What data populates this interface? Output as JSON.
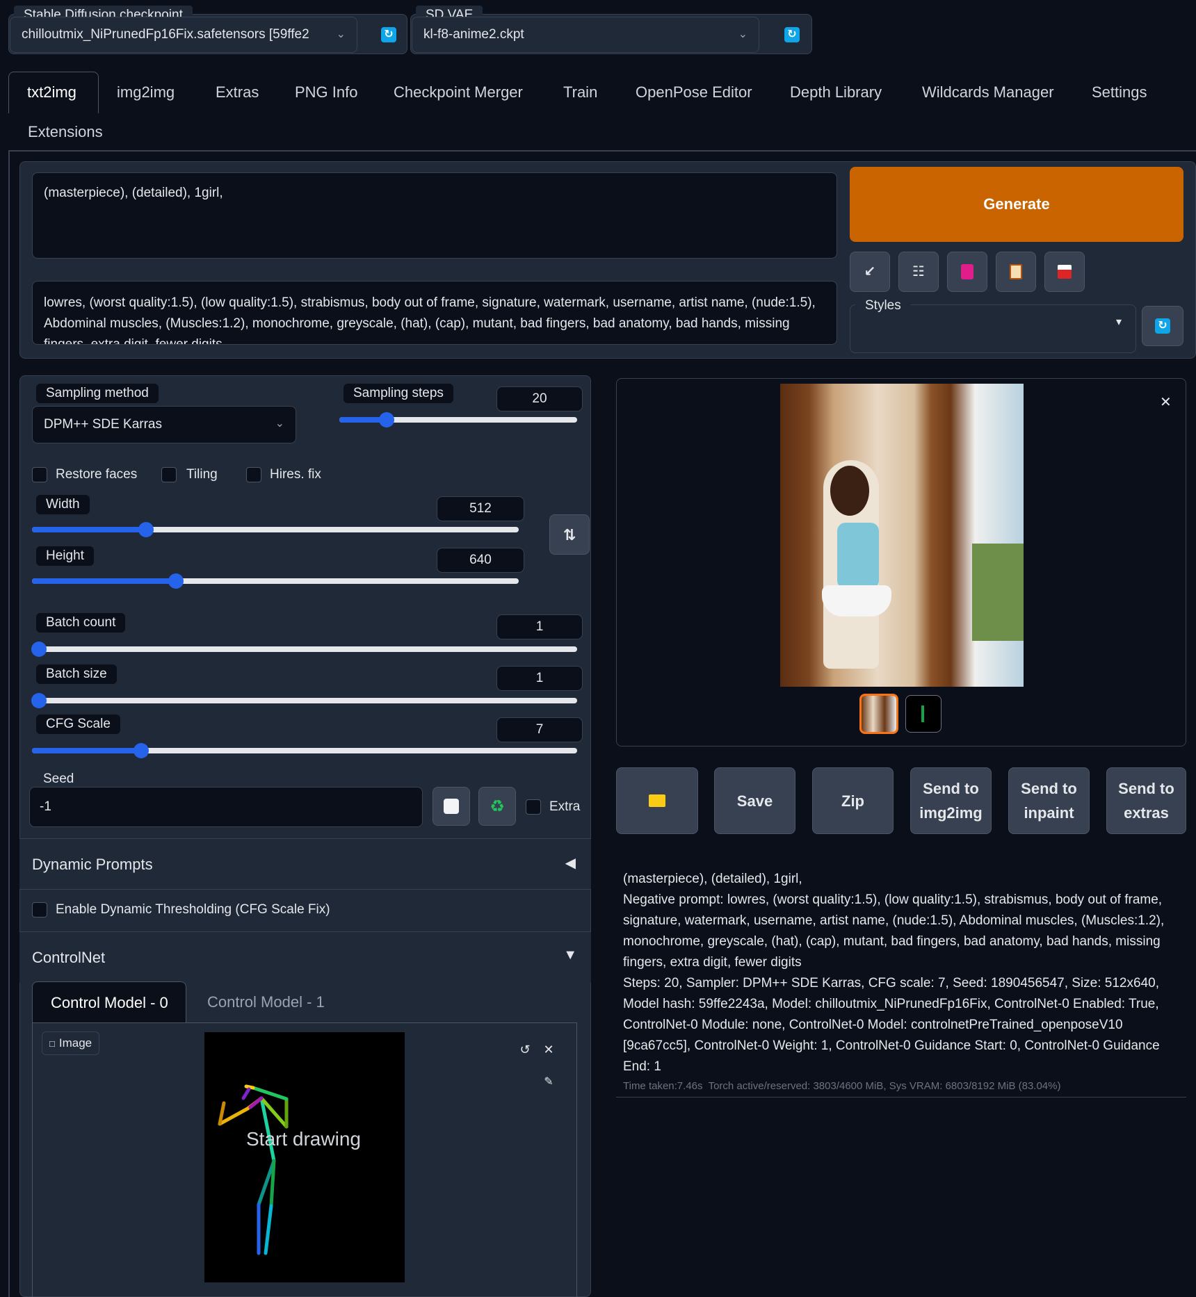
{
  "checkpoint": {
    "label": "Stable Diffusion checkpoint",
    "value": "chilloutmix_NiPrunedFp16Fix.safetensors [59ffe2"
  },
  "vae": {
    "label": "SD VAE",
    "value": "kl-f8-anime2.ckpt"
  },
  "tabs": [
    "txt2img",
    "img2img",
    "Extras",
    "PNG Info",
    "Checkpoint Merger",
    "Train",
    "OpenPose Editor",
    "Depth Library",
    "Wildcards Manager",
    "Settings",
    "Extensions"
  ],
  "prompt": {
    "positive": "(masterpiece), (detailed), 1girl,",
    "negative": "lowres, (worst quality:1.5), (low quality:1.5), strabismus, body out of frame, signature, watermark, username, artist name, (nude:1.5), Abdominal muscles, (Muscles:1.2), monochrome, greyscale, (hat), (cap), mutant, bad fingers, bad anatomy, bad hands, missing fingers, extra digit, fewer digits"
  },
  "generate_label": "Generate",
  "styles_label": "Styles",
  "sampling": {
    "method_label": "Sampling method",
    "method": "DPM++ SDE Karras",
    "steps_label": "Sampling steps",
    "steps": "20",
    "steps_frac": 0.2
  },
  "checks": {
    "restore": "Restore faces",
    "tiling": "Tiling",
    "hires": "Hires. fix"
  },
  "width": {
    "label": "Width",
    "value": "512",
    "frac": 0.234
  },
  "height": {
    "label": "Height",
    "value": "640",
    "frac": 0.296
  },
  "batch_count": {
    "label": "Batch count",
    "value": "1",
    "frac": 0
  },
  "batch_size": {
    "label": "Batch size",
    "value": "1",
    "frac": 0
  },
  "cfg": {
    "label": "CFG Scale",
    "value": "7",
    "frac": 0.2
  },
  "seed": {
    "label": "Seed",
    "value": "-1",
    "extra": "Extra"
  },
  "dynamic_prompts": "Dynamic Prompts",
  "dyn_thresh": "Enable Dynamic Thresholding (CFG Scale Fix)",
  "controlnet": {
    "title": "ControlNet",
    "tab0": "Control Model - 0",
    "tab1": "Control Model - 1",
    "image_label": "Image",
    "start_drawing": "Start drawing"
  },
  "actions": {
    "save": "Save",
    "zip": "Zip",
    "send_img2img": "Send to img2img",
    "send_inpaint": "Send to inpaint",
    "send_extras": "Send to extras"
  },
  "info": {
    "prompt": "(masterpiece), (detailed), 1girl,",
    "negative": "Negative prompt: lowres, (worst quality:1.5), (low quality:1.5), strabismus, body out of frame, signature, watermark, username, artist name, (nude:1.5), Abdominal muscles, (Muscles:1.2), monochrome, greyscale, (hat), (cap), mutant, bad fingers, bad anatomy, bad hands, missing fingers, extra digit, fewer digits",
    "params": "Steps: 20, Sampler: DPM++ SDE Karras, CFG scale: 7, Seed: 1890456547, Size: 512x640, Model hash: 59ffe2243a, Model: chilloutmix_NiPrunedFp16Fix, ControlNet-0 Enabled: True, ControlNet-0 Module: none, ControlNet-0 Model: controlnetPreTrained_openposeV10 [9ca67cc5], ControlNet-0 Weight: 1, ControlNet-0 Guidance Start: 0, ControlNet-0 Guidance End: 1",
    "timing": "Time taken:7.46s  Torch active/reserved: 3803/4600 MiB, Sys VRAM: 6803/8192 MiB (83.04%)"
  },
  "colors": {
    "accent": "#c96400",
    "slider": "#2563eb",
    "bg": "#0b0f19",
    "panel": "#1f2937"
  }
}
